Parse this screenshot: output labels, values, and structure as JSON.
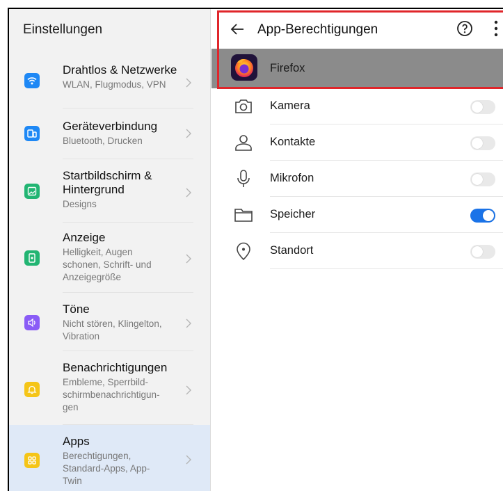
{
  "left_panel": {
    "title": "Einstellungen",
    "items": [
      {
        "title": "Drahtlos & Netzwerke",
        "subtitle": "WLAN, Flugmodus, VPN",
        "icon": "wifi-icon",
        "color": "#1e88f5"
      },
      {
        "title": "Geräteverbindung",
        "subtitle": "Bluetooth, Drucken",
        "icon": "device-connection-icon",
        "color": "#1e88f5"
      },
      {
        "title": "Startbildschirm & Hintergrund",
        "subtitle": "Designs",
        "icon": "wallpaper-icon",
        "color": "#22b573"
      },
      {
        "title": "Anzeige",
        "subtitle": "Helligkeit, Augen schonen, Schrift- und Anzeigegröße",
        "icon": "display-icon",
        "color": "#22b573"
      },
      {
        "title": "Töne",
        "subtitle": "Nicht stören, Klingelton, Vibration",
        "icon": "sound-icon",
        "color": "#8a5cf6"
      },
      {
        "title": "Benachrichtigungen",
        "subtitle": "Embleme, Sperrbild-schirmbenachrichtigun-gen",
        "icon": "bell-icon",
        "color": "#f5c518"
      },
      {
        "title": "Apps",
        "subtitle": "Berechtigungen, Standard-Apps, App-Twin",
        "icon": "apps-icon",
        "color": "#f5c518",
        "active": true
      }
    ]
  },
  "right_panel": {
    "title": "App-Berechtigungen",
    "app": {
      "name": "Firefox",
      "icon": "firefox-icon"
    },
    "permissions": [
      {
        "label": "Kamera",
        "icon": "camera-icon",
        "enabled": false
      },
      {
        "label": "Kontakte",
        "icon": "contacts-icon",
        "enabled": false
      },
      {
        "label": "Mikrofon",
        "icon": "microphone-icon",
        "enabled": false
      },
      {
        "label": "Speicher",
        "icon": "folder-icon",
        "enabled": true
      },
      {
        "label": "Standort",
        "icon": "location-icon",
        "enabled": false
      }
    ]
  },
  "colors": {
    "highlight": "#e0262b",
    "toggle_on": "#1a73e8",
    "active_item": "#dfe9f7"
  }
}
